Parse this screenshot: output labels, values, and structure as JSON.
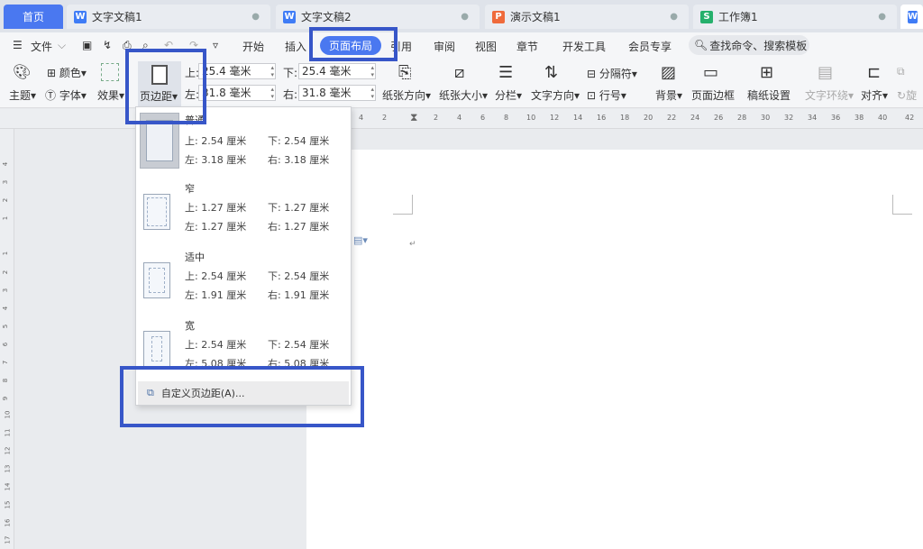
{
  "tabs": [
    {
      "label": "首页",
      "kind": "home"
    },
    {
      "label": "文字文稿1",
      "icon": "W",
      "kind": "w"
    },
    {
      "label": "文字文稿2",
      "icon": "W",
      "kind": "w"
    },
    {
      "label": "演示文稿1",
      "icon": "P",
      "kind": "p"
    },
    {
      "label": "工作簿1",
      "icon": "S",
      "kind": "s"
    },
    {
      "label": "W",
      "icon": "W",
      "kind": "w"
    }
  ],
  "menu": {
    "file": "文件",
    "items": [
      "开始",
      "插入",
      "页面布局",
      "引用",
      "审阅",
      "视图",
      "章节",
      "开发工具",
      "会员专享"
    ],
    "active": "页面布局",
    "search": "查找命令、搜索模板"
  },
  "ribbon": {
    "theme": "主题",
    "color": "颜色",
    "font": "字体",
    "effect": "效果",
    "margins": "页边距",
    "top_label": "上:",
    "top_value": "25.4 毫米",
    "bottom_label": "下:",
    "bottom_value": "25.4 毫米",
    "left_label": "左:",
    "left_value": "31.8 毫米",
    "right_label": "右:",
    "right_value": "31.8 毫米",
    "orientation": "纸张方向",
    "size": "纸张大小",
    "columns": "分栏",
    "text_direction": "文字方向",
    "separator": "分隔符",
    "line_number": "行号",
    "background": "背景",
    "page_border": "页面边框",
    "draft_setting": "稿纸设置",
    "text_wrap": "文字环绕",
    "align": "对齐",
    "rotate": "旋"
  },
  "ruler": {
    "h_ticks": [
      "4",
      "2",
      "2",
      "4",
      "6",
      "8",
      "10",
      "12",
      "14",
      "16",
      "18",
      "20",
      "22",
      "24",
      "26",
      "28",
      "30",
      "32",
      "34",
      "36",
      "38",
      "40",
      "42"
    ],
    "v_ticks": [
      "4",
      "3",
      "2",
      "1",
      "1",
      "2",
      "3",
      "4",
      "5",
      "6",
      "7",
      "8",
      "9",
      "10",
      "11",
      "12",
      "13",
      "14",
      "15",
      "16",
      "17"
    ]
  },
  "margin_presets": [
    {
      "name": "普通",
      "top": "上: 2.54 厘米",
      "bottom": "下: 2.54 厘米",
      "left": "左: 3.18 厘米",
      "right": "右: 3.18 厘米",
      "selected": true
    },
    {
      "name": "窄",
      "top": "上: 1.27 厘米",
      "bottom": "下: 1.27 厘米",
      "left": "左: 1.27 厘米",
      "right": "右: 1.27 厘米",
      "selected": false
    },
    {
      "name": "适中",
      "top": "上: 2.54 厘米",
      "bottom": "下: 2.54 厘米",
      "left": "左: 1.91 厘米",
      "right": "右: 1.91 厘米",
      "selected": false
    },
    {
      "name": "宽",
      "top": "上: 2.54 厘米",
      "bottom": "下: 2.54 厘米",
      "left": "左: 5.08 厘米",
      "right": "右: 5.08 厘米",
      "selected": false
    }
  ],
  "custom_margins": "自定义页边距(A)...",
  "colors": {
    "accent": "#4a78f0",
    "highlight": "#3756c8"
  }
}
